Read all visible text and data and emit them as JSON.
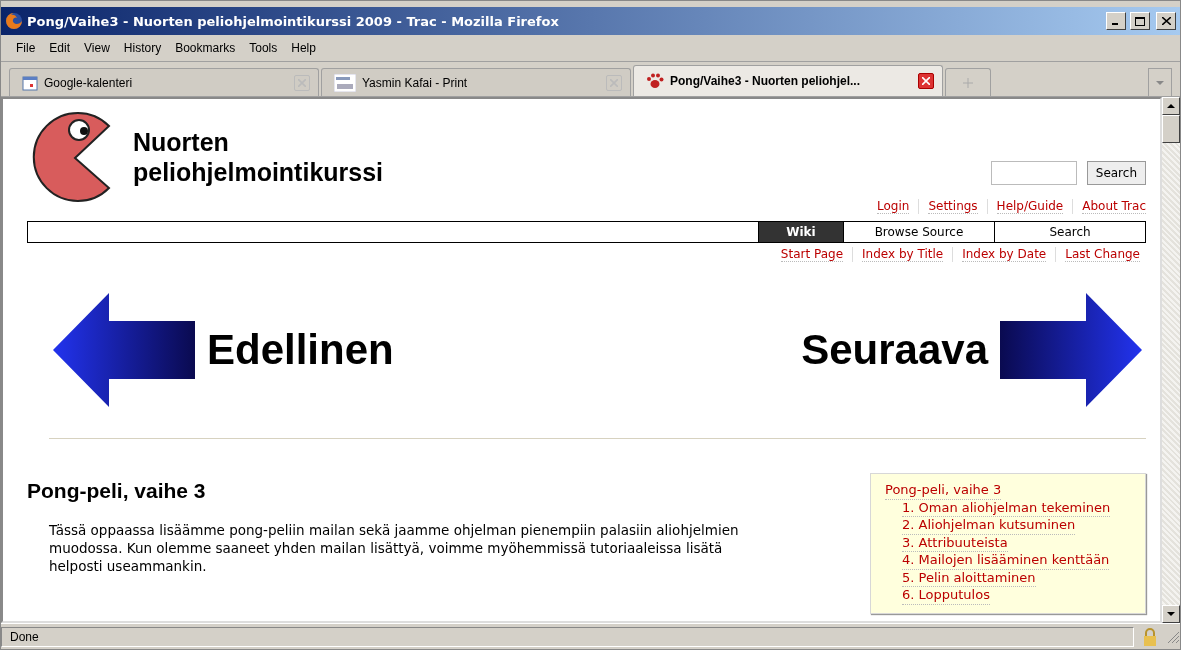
{
  "window": {
    "title": "Pong/Vaihe3 - Nuorten peliohjelmointikurssi 2009 - Trac - Mozilla Firefox"
  },
  "menu": [
    "File",
    "Edit",
    "View",
    "History",
    "Bookmarks",
    "Tools",
    "Help"
  ],
  "tabs": [
    {
      "label": "Google-kalenteri",
      "selected": false,
      "kind": "calendar"
    },
    {
      "label": "Yasmin Kafai - Print",
      "selected": false,
      "kind": "document"
    },
    {
      "label": "Pong/Vaihe3 - Nuorten peliohjel...",
      "selected": true,
      "kind": "paw"
    }
  ],
  "site": {
    "logo_lines": [
      "Nuorten",
      "peliohjelmointikurssi"
    ],
    "search_button": "Search",
    "meta_nav": [
      "Login",
      "Settings",
      "Help/Guide",
      "About Trac"
    ],
    "main_nav": [
      {
        "label": "Wiki",
        "selected": true
      },
      {
        "label": "Browse Source",
        "selected": false
      },
      {
        "label": "Search",
        "selected": false
      }
    ],
    "context_nav": [
      "Start Page",
      "Index by Title",
      "Index by Date",
      "Last Change"
    ]
  },
  "navigation": {
    "previous": "Edellinen",
    "next": "Seuraava"
  },
  "article": {
    "heading": "Pong-peli, vaihe 3",
    "paragraph": "Tässä oppaassa lisäämme pong-peliin mailan sekä jaamme ohjelman pienempiin palasiin aliohjelmien muodossa. Kun olemme saaneet yhden mailan lisättyä, voimme myöhemmissä tutoriaaleissa lisätä helposti useammankin."
  },
  "toc": {
    "title": "Pong-peli, vaihe 3",
    "items": [
      "1. Oman aliohjelman tekeminen",
      "2. Aliohjelman kutsuminen",
      "3. Attribuuteista",
      "4. Mailojen lisääminen kenttään",
      "5. Pelin aloittaminen",
      "6. Lopputulos"
    ]
  },
  "status_bar": "Done"
}
